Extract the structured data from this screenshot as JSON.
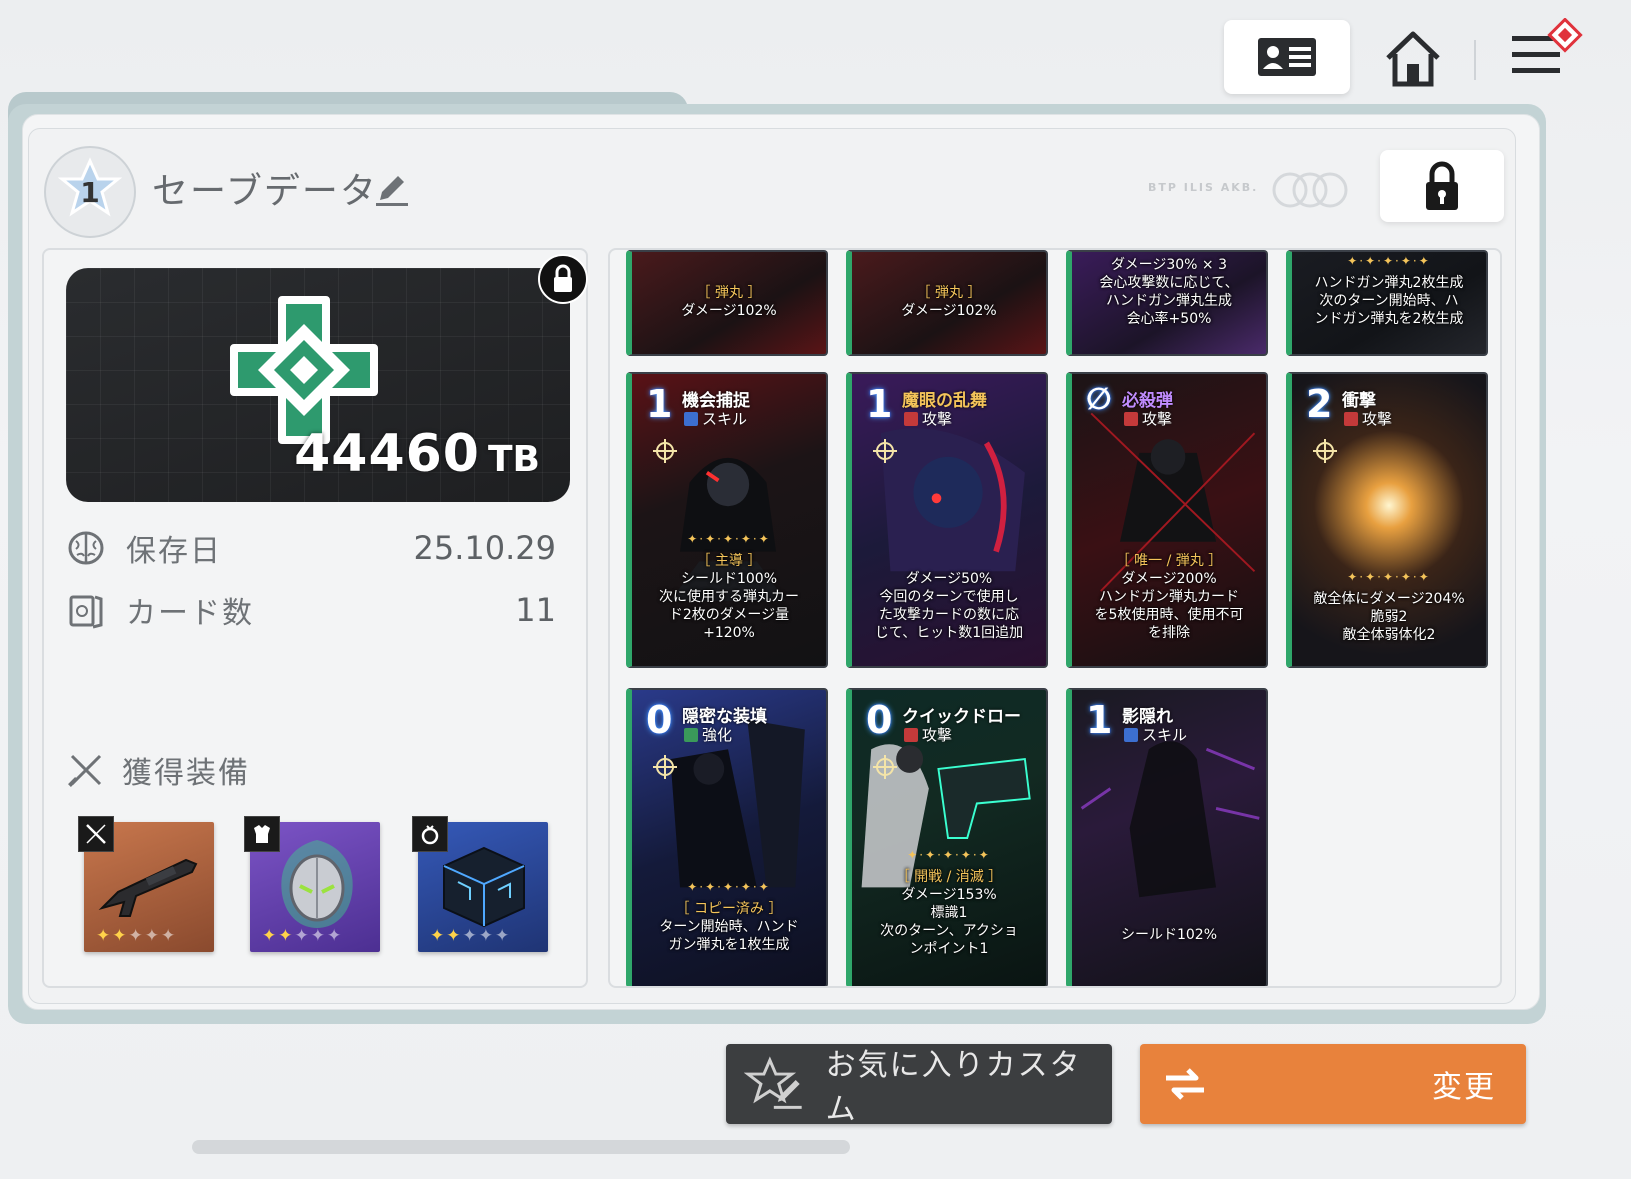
{
  "topbar": {
    "profile_icon": "id-card-icon",
    "home_icon": "home-icon",
    "menu_icon": "hamburger-menu-icon",
    "notification_badge_color": "#e0323c"
  },
  "header": {
    "slot_number": "1",
    "title": "セーブデータ",
    "faint_label": "BTP ILIS AKB.",
    "lock_icon": "padlock-icon"
  },
  "capacity": {
    "value": "44460",
    "unit": "TB"
  },
  "info": {
    "save_date_label": "保存日",
    "save_date_value": "25.10.29",
    "card_count_label": "カード数",
    "card_count_value": "11"
  },
  "equipment": {
    "title": "獲得装備",
    "items": [
      {
        "type": "weapon",
        "name": "rifle",
        "stars_on": 2,
        "stars_total": 5,
        "bg": "#b8633f"
      },
      {
        "type": "armor",
        "name": "helmet",
        "stars_on": 2,
        "stars_total": 5,
        "bg": "#6e45b8"
      },
      {
        "type": "accessory",
        "name": "cube",
        "stars_on": 2,
        "stars_total": 5,
        "bg": "#2d4fa8"
      }
    ]
  },
  "cards_top_row": [
    {
      "tag": "［ 弾丸 ］",
      "desc": "ダメージ102%"
    },
    {
      "tag": "［ 弾丸 ］",
      "desc": "ダメージ102%"
    },
    {
      "line1": "ダメージ30% × 3",
      "line2": "会心攻撃数に応じて、",
      "line3": "ハンドガン弾丸生成",
      "line4": "会心率+50%"
    },
    {
      "line1": "ハンドガン弾丸2枚生成",
      "line2": "次のターン開始時、ハ",
      "line3": "ンドガン弾丸を2枚生成"
    }
  ],
  "cards_mid_row": [
    {
      "cost": "1",
      "name": "機会捕捉",
      "type": "スキル",
      "tag": "［ 主導 ］",
      "l1": "シールド100%",
      "l2": "次に使用する弾丸カー",
      "l3": "ド2枚のダメージ量",
      "l4": "+120%"
    },
    {
      "cost": "1",
      "name": "魔眼の乱舞",
      "type": "攻撃",
      "l1": "ダメージ50%",
      "l2": "今回のターンで使用し",
      "l3": "た攻撃カードの数に応",
      "l4": "じて、ヒット数1回追加"
    },
    {
      "cost": "∅",
      "name": "必殺弾",
      "type": "攻撃",
      "tag": "［ 唯一 / 弾丸 ］",
      "l1": "ダメージ200%",
      "l2": "ハンドガン弾丸カード",
      "l3": "を5枚使用時、使用不可",
      "l4": "を排除"
    },
    {
      "cost": "2",
      "name": "衝撃",
      "type": "攻撃",
      "l1": "敵全体にダメージ204%",
      "l2": "脆弱2",
      "l3": "敵全体弱体化2"
    }
  ],
  "cards_bottom_row": [
    {
      "cost": "0",
      "name": "隠密な装填",
      "type": "強化",
      "tag": "［ コピー済み ］",
      "l1": "ターン開始時、ハンド",
      "l2": "ガン弾丸を1枚生成"
    },
    {
      "cost": "0",
      "name": "クイックドロー",
      "type": "攻撃",
      "tag": "［ 開戦 / 消滅 ］",
      "l1": "ダメージ153%",
      "l2": "標識1",
      "l3": "次のターン、アクショ",
      "l4": "ンポイント1"
    },
    {
      "cost": "1",
      "name": "影隠れ",
      "type": "スキル",
      "l1": "シールド102%"
    }
  ],
  "buttons": {
    "favorite_custom": "お気に入りカスタム",
    "change": "変更"
  },
  "colors": {
    "accent_orange": "#e8823c",
    "panel_teal": "#b8c9cc",
    "card_border_green": "#2fa66a"
  }
}
